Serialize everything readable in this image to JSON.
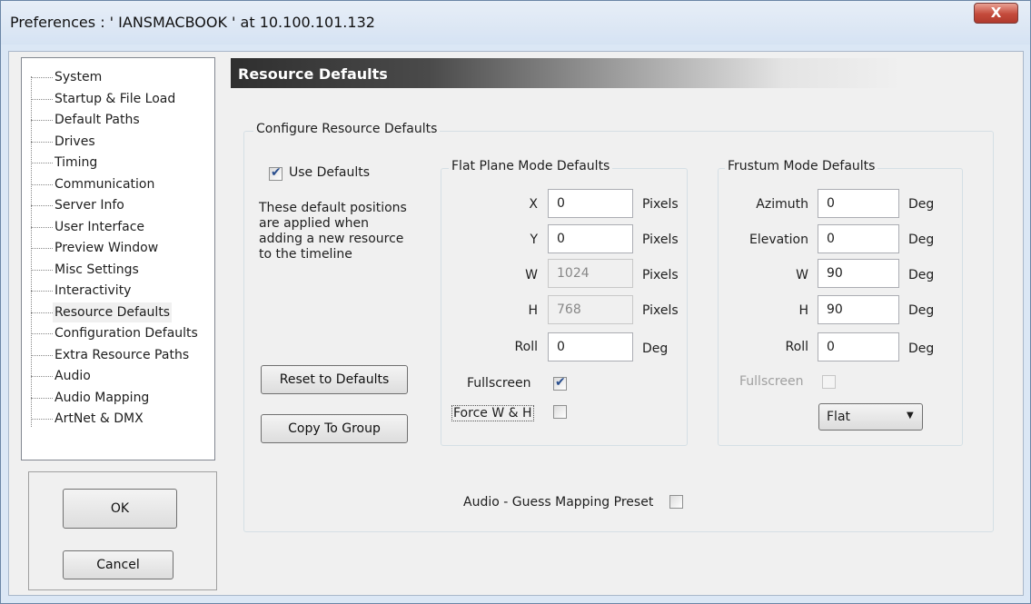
{
  "window": {
    "title": "Preferences :  ' IANSMACBOOK '  at  10.100.101.132",
    "close_glyph": "X"
  },
  "nav": {
    "items": [
      {
        "label": "System",
        "selected": false
      },
      {
        "label": "Startup & File Load",
        "selected": false
      },
      {
        "label": "Default Paths",
        "selected": false
      },
      {
        "label": "Drives",
        "selected": false
      },
      {
        "label": "Timing",
        "selected": false
      },
      {
        "label": "Communication",
        "selected": false
      },
      {
        "label": "Server Info",
        "selected": false
      },
      {
        "label": "User Interface",
        "selected": false
      },
      {
        "label": "Preview Window",
        "selected": false
      },
      {
        "label": "Misc Settings",
        "selected": false
      },
      {
        "label": "Interactivity",
        "selected": false
      },
      {
        "label": "Resource Defaults",
        "selected": true
      },
      {
        "label": "Configuration Defaults",
        "selected": false
      },
      {
        "label": "Extra Resource Paths",
        "selected": false
      },
      {
        "label": "Audio",
        "selected": false
      },
      {
        "label": "Audio Mapping",
        "selected": false
      },
      {
        "label": "ArtNet & DMX",
        "selected": false
      }
    ]
  },
  "buttons": {
    "ok": "OK",
    "cancel": "Cancel",
    "reset": "Reset to Defaults",
    "copy_group": "Copy To Group"
  },
  "page": {
    "title": "Resource Defaults",
    "group_title": "Configure Resource Defaults",
    "use_defaults_label": "Use Defaults",
    "use_defaults_checked": true,
    "description": [
      "These default positions",
      "are applied when",
      "adding a new resource",
      "to the timeline"
    ],
    "audio_guess_label": "Audio - Guess Mapping Preset",
    "audio_guess_checked": false
  },
  "flat": {
    "title": "Flat Plane Mode Defaults",
    "x_label": "X",
    "x_value": "0",
    "x_unit": "Pixels",
    "y_label": "Y",
    "y_value": "0",
    "y_unit": "Pixels",
    "w_label": "W",
    "w_value": "1024",
    "w_unit": "Pixels",
    "h_label": "H",
    "h_value": "768",
    "h_unit": "Pixels",
    "roll_label": "Roll",
    "roll_value": "0",
    "roll_unit": "Deg",
    "fullscreen_label": "Fullscreen",
    "fullscreen_checked": true,
    "force_label": "Force W & H",
    "force_checked": false
  },
  "frustum": {
    "title": "Frustum Mode Defaults",
    "azimuth_label": "Azimuth",
    "azimuth_value": "0",
    "azimuth_unit": "Deg",
    "elevation_label": "Elevation",
    "elevation_value": "0",
    "elevation_unit": "Deg",
    "w_label": "W",
    "w_value": "90",
    "w_unit": "Deg",
    "h_label": "H",
    "h_value": "90",
    "h_unit": "Deg",
    "roll_label": "Roll",
    "roll_value": "0",
    "roll_unit": "Deg",
    "fullscreen_label": "Fullscreen",
    "fullscreen_checked": false,
    "mode_select": "Flat"
  }
}
